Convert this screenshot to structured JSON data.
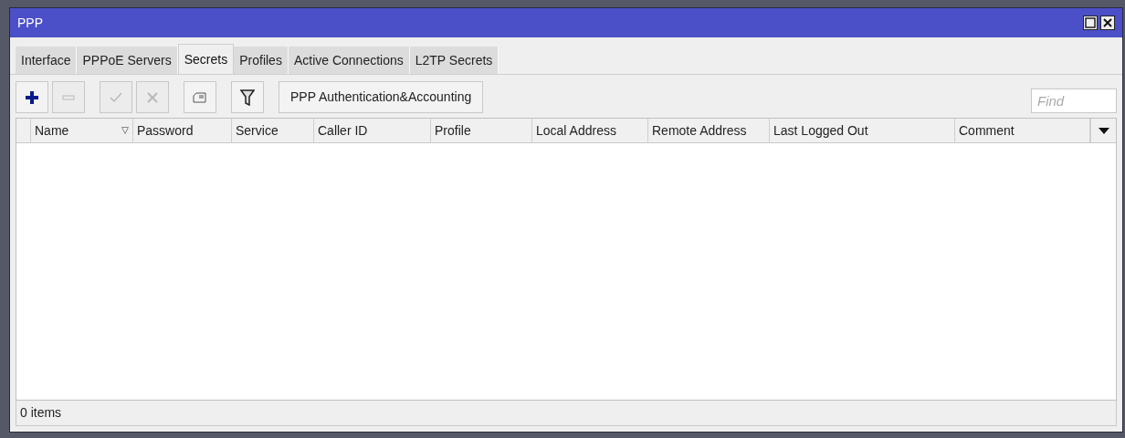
{
  "window": {
    "title": "PPP"
  },
  "tabs": [
    {
      "label": "Interface",
      "selected": false
    },
    {
      "label": "PPPoE Servers",
      "selected": false
    },
    {
      "label": "Secrets",
      "selected": true
    },
    {
      "label": "Profiles",
      "selected": false
    },
    {
      "label": "Active Connections",
      "selected": false
    },
    {
      "label": "L2TP Secrets",
      "selected": false
    }
  ],
  "toolbar": [
    {
      "kind": "add",
      "disabled": false
    },
    {
      "kind": "remove",
      "disabled": true
    },
    {
      "kind": "enable",
      "disabled": true
    },
    {
      "kind": "disable",
      "disabled": true
    },
    {
      "kind": "comment",
      "disabled": false
    },
    {
      "kind": "filter",
      "disabled": false
    }
  ],
  "toolbar_button": "PPP Authentication&Accounting",
  "search": {
    "placeholder": "Find"
  },
  "table": {
    "columns": [
      {
        "label": "Name",
        "sorted": true
      },
      {
        "label": "Password",
        "sorted": false
      },
      {
        "label": "Service",
        "sorted": false
      },
      {
        "label": "Caller ID",
        "sorted": false
      },
      {
        "label": "Profile",
        "sorted": false
      },
      {
        "label": "Local Address",
        "sorted": false
      },
      {
        "label": "Remote Address",
        "sorted": false
      },
      {
        "label": "Last Logged Out",
        "sorted": false
      },
      {
        "label": "Comment",
        "sorted": false
      }
    ]
  },
  "status_bar": "0 items"
}
